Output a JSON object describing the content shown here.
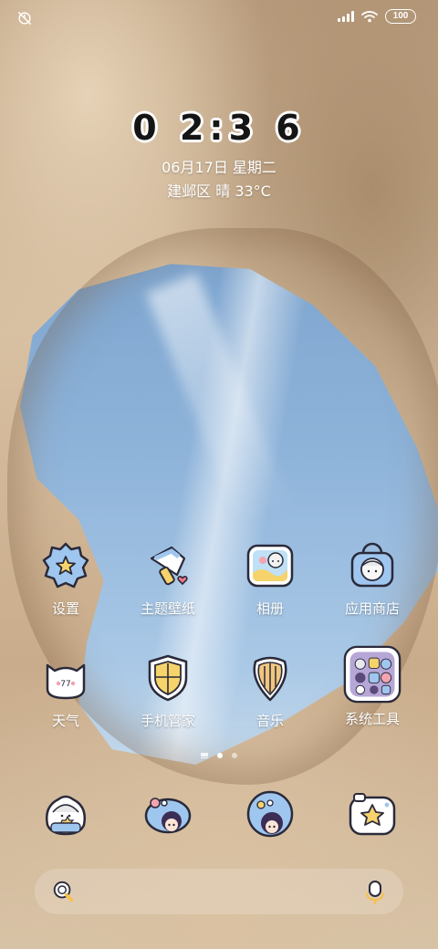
{
  "status_bar": {
    "dnd_icon": "dnd-off-icon",
    "signal_icon": "signal-icon",
    "wifi_icon": "wifi-icon",
    "battery": "100"
  },
  "lockclock": {
    "time": "0 2:3 6",
    "date": "06月17日 星期二",
    "weather": "建邺区 晴 33°C"
  },
  "apps_row1": [
    {
      "label": "设置",
      "icon": "settings-icon"
    },
    {
      "label": "主题壁纸",
      "icon": "theme-wallpaper-icon"
    },
    {
      "label": "相册",
      "icon": "gallery-icon"
    },
    {
      "label": "应用商店",
      "icon": "app-store-icon"
    }
  ],
  "apps_row2": [
    {
      "label": "天气",
      "icon": "weather-icon"
    },
    {
      "label": "手机管家",
      "icon": "phone-manager-icon"
    },
    {
      "label": "音乐",
      "icon": "music-icon"
    },
    {
      "label": "系统工具",
      "icon": "system-tools-folder-icon"
    }
  ],
  "dock": [
    {
      "icon": "phone-icon"
    },
    {
      "icon": "messages-icon"
    },
    {
      "icon": "browser-icon"
    },
    {
      "icon": "camera-icon"
    }
  ],
  "search_bar": {
    "search_icon": "search-icon",
    "mic_icon": "microphone-icon"
  },
  "colors": {
    "sky": "#8fb4da",
    "sand": "#cdb294",
    "icon_blue": "#9fc6ee",
    "icon_yellow": "#f6d36b"
  }
}
